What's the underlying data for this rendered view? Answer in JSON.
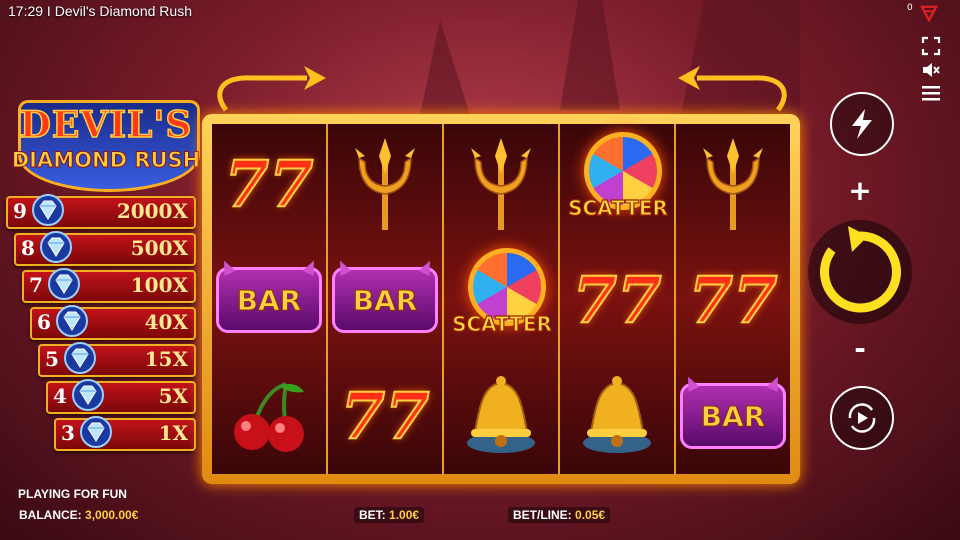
{
  "window": {
    "title": "17:29 I Devil's Diamond Rush",
    "counter": "0"
  },
  "logo": {
    "line1": "DEVIL'S",
    "line2": "DIAMOND RUSH"
  },
  "paytable": [
    {
      "count": "9",
      "win": "2000X",
      "gem_label": "DIAMOND RUSH"
    },
    {
      "count": "8",
      "win": "500X",
      "gem_label": "DIAMOND RUSH"
    },
    {
      "count": "7",
      "win": "100X",
      "gem_label": "DIAMOND RUSH"
    },
    {
      "count": "6",
      "win": "40X",
      "gem_label": "DIAMOND RUSH"
    },
    {
      "count": "5",
      "win": "15X",
      "gem_label": "DIAMOND RUSH"
    },
    {
      "count": "4",
      "win": "5X",
      "gem_label": "DIAMOND RUSH"
    },
    {
      "count": "3",
      "win": "1X",
      "gem_label": "DIAMOND RUSH"
    }
  ],
  "reels": [
    [
      "seven",
      "bar",
      "cherry"
    ],
    [
      "trident",
      "bar",
      "seven"
    ],
    [
      "trident",
      "scatter",
      "bell"
    ],
    [
      "scatter",
      "seven",
      "bell"
    ],
    [
      "trident",
      "seven",
      "bar"
    ]
  ],
  "symbols": {
    "bar": "BAR",
    "scatter": "SCATTER",
    "seven": "77"
  },
  "controls": {
    "plus": "+",
    "minus": "-"
  },
  "status": {
    "mode": "PLAYING FOR FUN",
    "balance_label": "BALANCE:",
    "balance_value": "3,000.00€",
    "bet_label": "BET:",
    "bet_value": "1.00€",
    "betline_label": "BET/LINE:",
    "betline_value": "0.05€"
  },
  "colors": {
    "accent": "#ffd040",
    "frame": "#e8a020",
    "spin_ring": "#ffe020"
  }
}
